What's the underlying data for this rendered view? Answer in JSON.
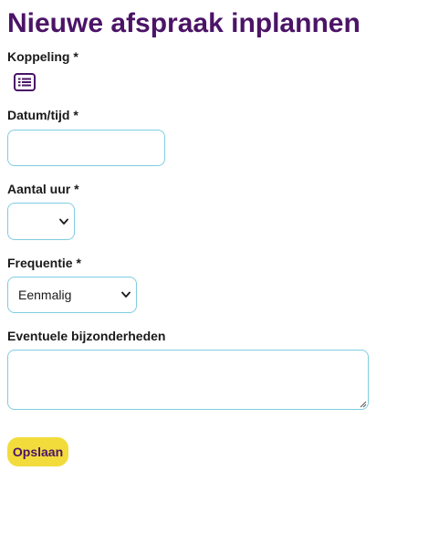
{
  "page_title": "Nieuwe afspraak inplannen",
  "koppeling": {
    "label": "Koppeling *",
    "icon": "list-icon"
  },
  "datum_tijd": {
    "label": "Datum/tijd *",
    "value": ""
  },
  "aantal_uur": {
    "label": "Aantal uur *",
    "selected": ""
  },
  "frequentie": {
    "label": "Frequentie *",
    "selected": "Eenmalig"
  },
  "bijzonderheden": {
    "label": "Eventuele bijzonderheden",
    "value": ""
  },
  "save_button": {
    "label": "Opslaan"
  },
  "colors": {
    "title": "#4b1466",
    "input_border": "#7fcde0",
    "button_bg": "#f2dc3c",
    "button_text": "#4b1466"
  }
}
